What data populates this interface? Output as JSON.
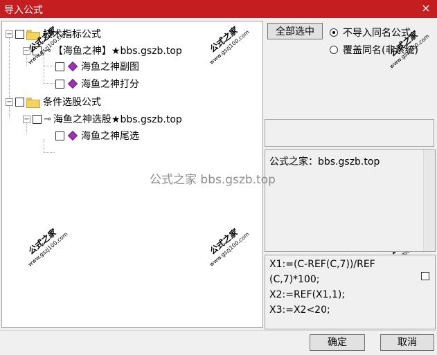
{
  "window": {
    "title": "导入公式",
    "close_glyph": "×"
  },
  "tree": {
    "expand_minus": "−",
    "items": [
      {
        "label": "技术指标公式"
      },
      {
        "label": "【海鱼之神】★bbs.gszb.top"
      },
      {
        "label": "海鱼之神副图"
      },
      {
        "label": "海鱼之神打分"
      },
      {
        "label": "条件选股公式"
      },
      {
        "label": "海鱼之神选股★bbs.gszb.top"
      },
      {
        "label": "海鱼之神尾选"
      }
    ]
  },
  "watermark": {
    "name": "公式之家",
    "url": "www.gszj100.com",
    "center": "公式之家 bbs.gszb.top"
  },
  "options": {
    "select_all": "全部选中",
    "radio_skip": "不导入同名公式",
    "radio_overwrite": "覆盖同名(非系统)",
    "radio_selected": "skip"
  },
  "info": {
    "text": "公式之家：bbs.gszb.top"
  },
  "code": {
    "lines": [
      "X1:=(C-REF(C,7))/REF",
      "(C,7)*100;",
      "X2:=REF(X1,1);",
      "X3:=X2<20;"
    ]
  },
  "buttons": {
    "ok": "确定",
    "cancel": "取消"
  }
}
